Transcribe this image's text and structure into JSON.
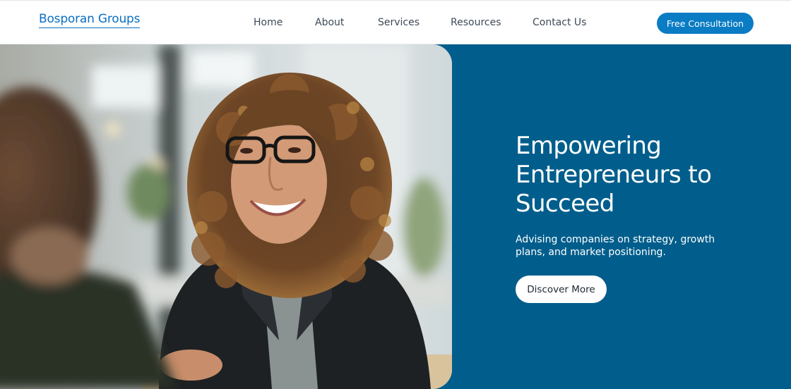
{
  "brand": {
    "name": "Bosporan Groups",
    "color": "#0a6fc2"
  },
  "nav": {
    "items": [
      {
        "label": "Home"
      },
      {
        "label": "About"
      },
      {
        "label": "Services"
      },
      {
        "label": "Resources"
      },
      {
        "label": "Contact Us"
      }
    ],
    "cta_label": "Free Consultation"
  },
  "hero": {
    "title": "Empowering Entrepreneurs to Succeed",
    "subtitle": "Advising companies on strategy, growth plans, and market positioning.",
    "button_label": "Discover More",
    "background_color": "#015e8c",
    "image": "smiling woman with curly hair and glasses in a business meeting"
  },
  "colors": {
    "accent": "#0a7cc4",
    "hero_bg": "#015e8c",
    "nav_text": "#3d4a58"
  }
}
